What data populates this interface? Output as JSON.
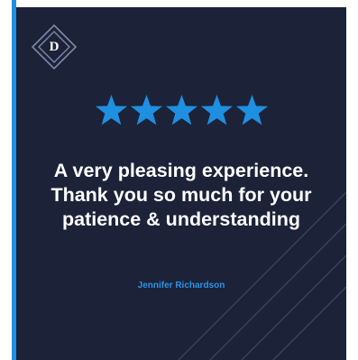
{
  "logo": {
    "letter": "D"
  },
  "rating": {
    "stars": 5,
    "max": 5,
    "color": "#1f8fe0"
  },
  "testimonial": {
    "quote": "A very pleasing experience. Thank you so much for your patience & understanding",
    "author": "Jennifer Richardson"
  },
  "colors": {
    "background": "#1c2238",
    "accent": "#1f8fe0",
    "text": "#ffffff"
  }
}
